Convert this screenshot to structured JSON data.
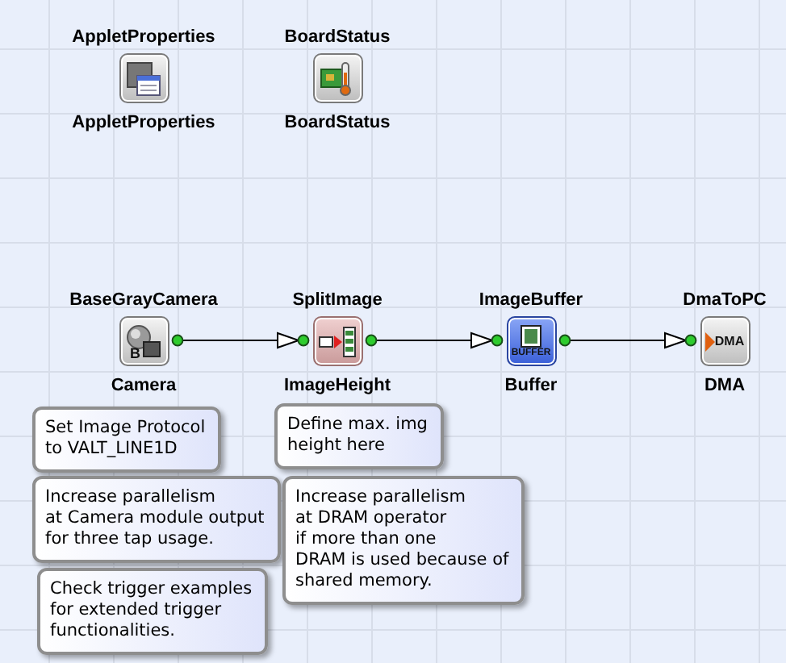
{
  "nodes": [
    {
      "title": "AppletProperties",
      "caption": "AppletProperties",
      "kind": "applet",
      "connected_to_next": false
    },
    {
      "title": "BoardStatus",
      "caption": "BoardStatus",
      "kind": "board",
      "connected_to_next": false
    },
    {
      "title": "BaseGrayCamera",
      "caption": "Camera",
      "kind": "camera",
      "icon_text": "B",
      "connected_to_next": true
    },
    {
      "title": "SplitImage",
      "caption": "ImageHeight",
      "kind": "split",
      "connected_to_next": true
    },
    {
      "title": "ImageBuffer",
      "caption": "Buffer",
      "kind": "buffer",
      "icon_text": "BUFFER",
      "connected_to_next": true
    },
    {
      "title": "DmaToPC",
      "caption": "DMA",
      "kind": "dma",
      "icon_text": "DMA",
      "connected_to_next": false
    }
  ],
  "notes": [
    {
      "text": "Set Image Protocol\nto VALT_LINE1D"
    },
    {
      "text": "Increase parallelism\nat Camera module output\nfor three tap usage."
    },
    {
      "text": "Check trigger examples\nfor extended trigger\nfunctionalities."
    },
    {
      "text": "Define max. img\nheight here"
    },
    {
      "text": "Increase parallelism\nat DRAM operator\nif more than one\nDRAM is used because of\nshared memory."
    }
  ]
}
